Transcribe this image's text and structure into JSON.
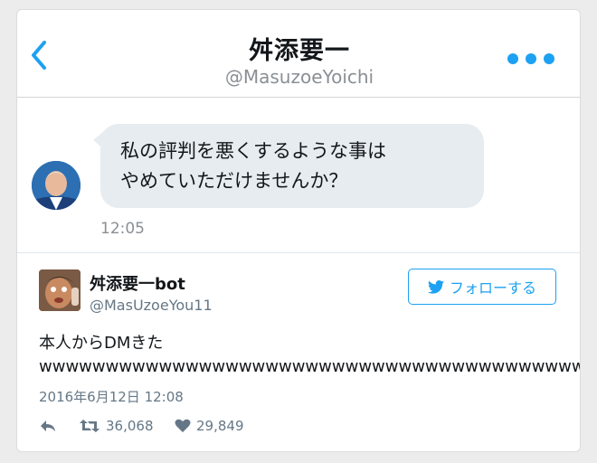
{
  "dm_header": {
    "name": "舛添要一",
    "handle": "@MasuzoeYoichi"
  },
  "message": {
    "lines": [
      "私の評判を悪くするような事は",
      "やめていただけませんか？"
    ],
    "time": "12:05"
  },
  "tweet": {
    "user_name": "舛添要一bot",
    "user_handle": "@MasUzoeYou11",
    "follow_label": "フォローする",
    "text_line1": "本人からDMきた",
    "text_line2": "wwwwwwwwwwwwwwwwwwwwwwwwwwwwwwwwwwwwwwwwwwwwwwwwwwwwwwww",
    "date": "2016年6月12日 12:08",
    "retweets": "36,068",
    "likes": "29,849"
  },
  "colors": {
    "accent": "#1da1f2",
    "bubble": "#e6ecf0",
    "muted_text": "#657786"
  },
  "icons": [
    "back-chevron-icon",
    "more-dots-icon",
    "twitter-bird-icon",
    "reply-icon",
    "retweet-icon",
    "heart-icon"
  ]
}
